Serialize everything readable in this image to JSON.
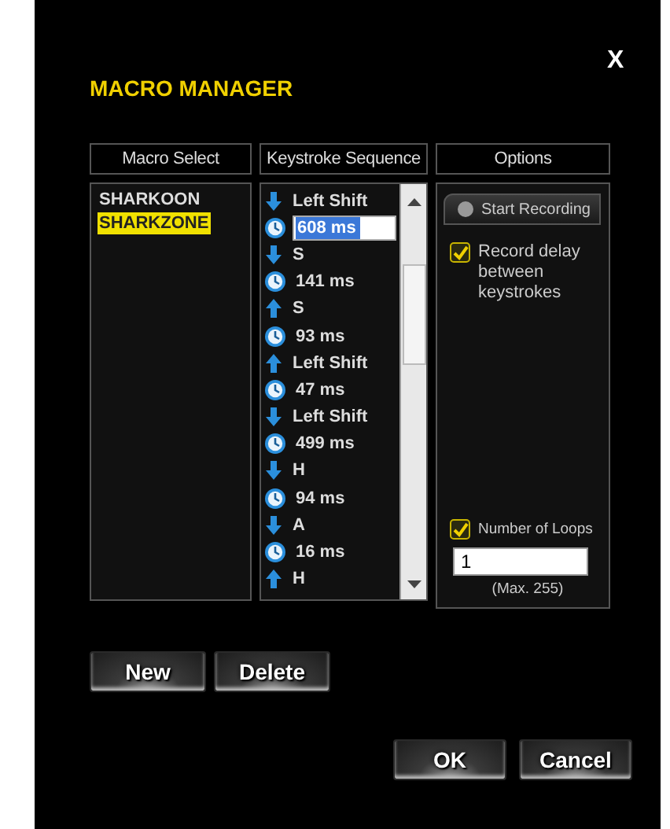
{
  "window": {
    "title": "MACRO MANAGER",
    "close": "X"
  },
  "columns": [
    "Macro Select",
    "Keystroke Sequence",
    "Options"
  ],
  "macros": [
    {
      "label": "SHARKOON",
      "selected": false
    },
    {
      "label": "SHARKZONE",
      "selected": true
    }
  ],
  "keystrokes": [
    {
      "kind": "key",
      "released": false,
      "label": "Left Shift"
    },
    {
      "kind": "delay",
      "label": "608 ms",
      "editing": true
    },
    {
      "kind": "key",
      "released": false,
      "label": "S"
    },
    {
      "kind": "delay",
      "label": "141 ms",
      "editing": false
    },
    {
      "kind": "key",
      "released": true,
      "label": "S"
    },
    {
      "kind": "delay",
      "label": "93 ms",
      "editing": false
    },
    {
      "kind": "key",
      "released": true,
      "label": "Left Shift"
    },
    {
      "kind": "delay",
      "label": "47 ms",
      "editing": false
    },
    {
      "kind": "key",
      "released": false,
      "label": "Left Shift"
    },
    {
      "kind": "delay",
      "label": "499 ms",
      "editing": false
    },
    {
      "kind": "key",
      "released": false,
      "label": "H"
    },
    {
      "kind": "delay",
      "label": "94 ms",
      "editing": false
    },
    {
      "kind": "key",
      "released": false,
      "label": "A"
    },
    {
      "kind": "delay",
      "label": "16 ms",
      "editing": false
    },
    {
      "kind": "key",
      "released": true,
      "label": "H"
    }
  ],
  "options": {
    "start_recording": "Start Recording",
    "record_delay": {
      "label": "Record delay between keystrokes",
      "checked": true
    },
    "loops": {
      "label": "Number of Loops",
      "checked": true,
      "value": "1",
      "hint": "(Max. 255)"
    }
  },
  "macro_buttons": [
    "New",
    "Delete"
  ],
  "dialog_buttons": [
    "OK",
    "Cancel"
  ]
}
